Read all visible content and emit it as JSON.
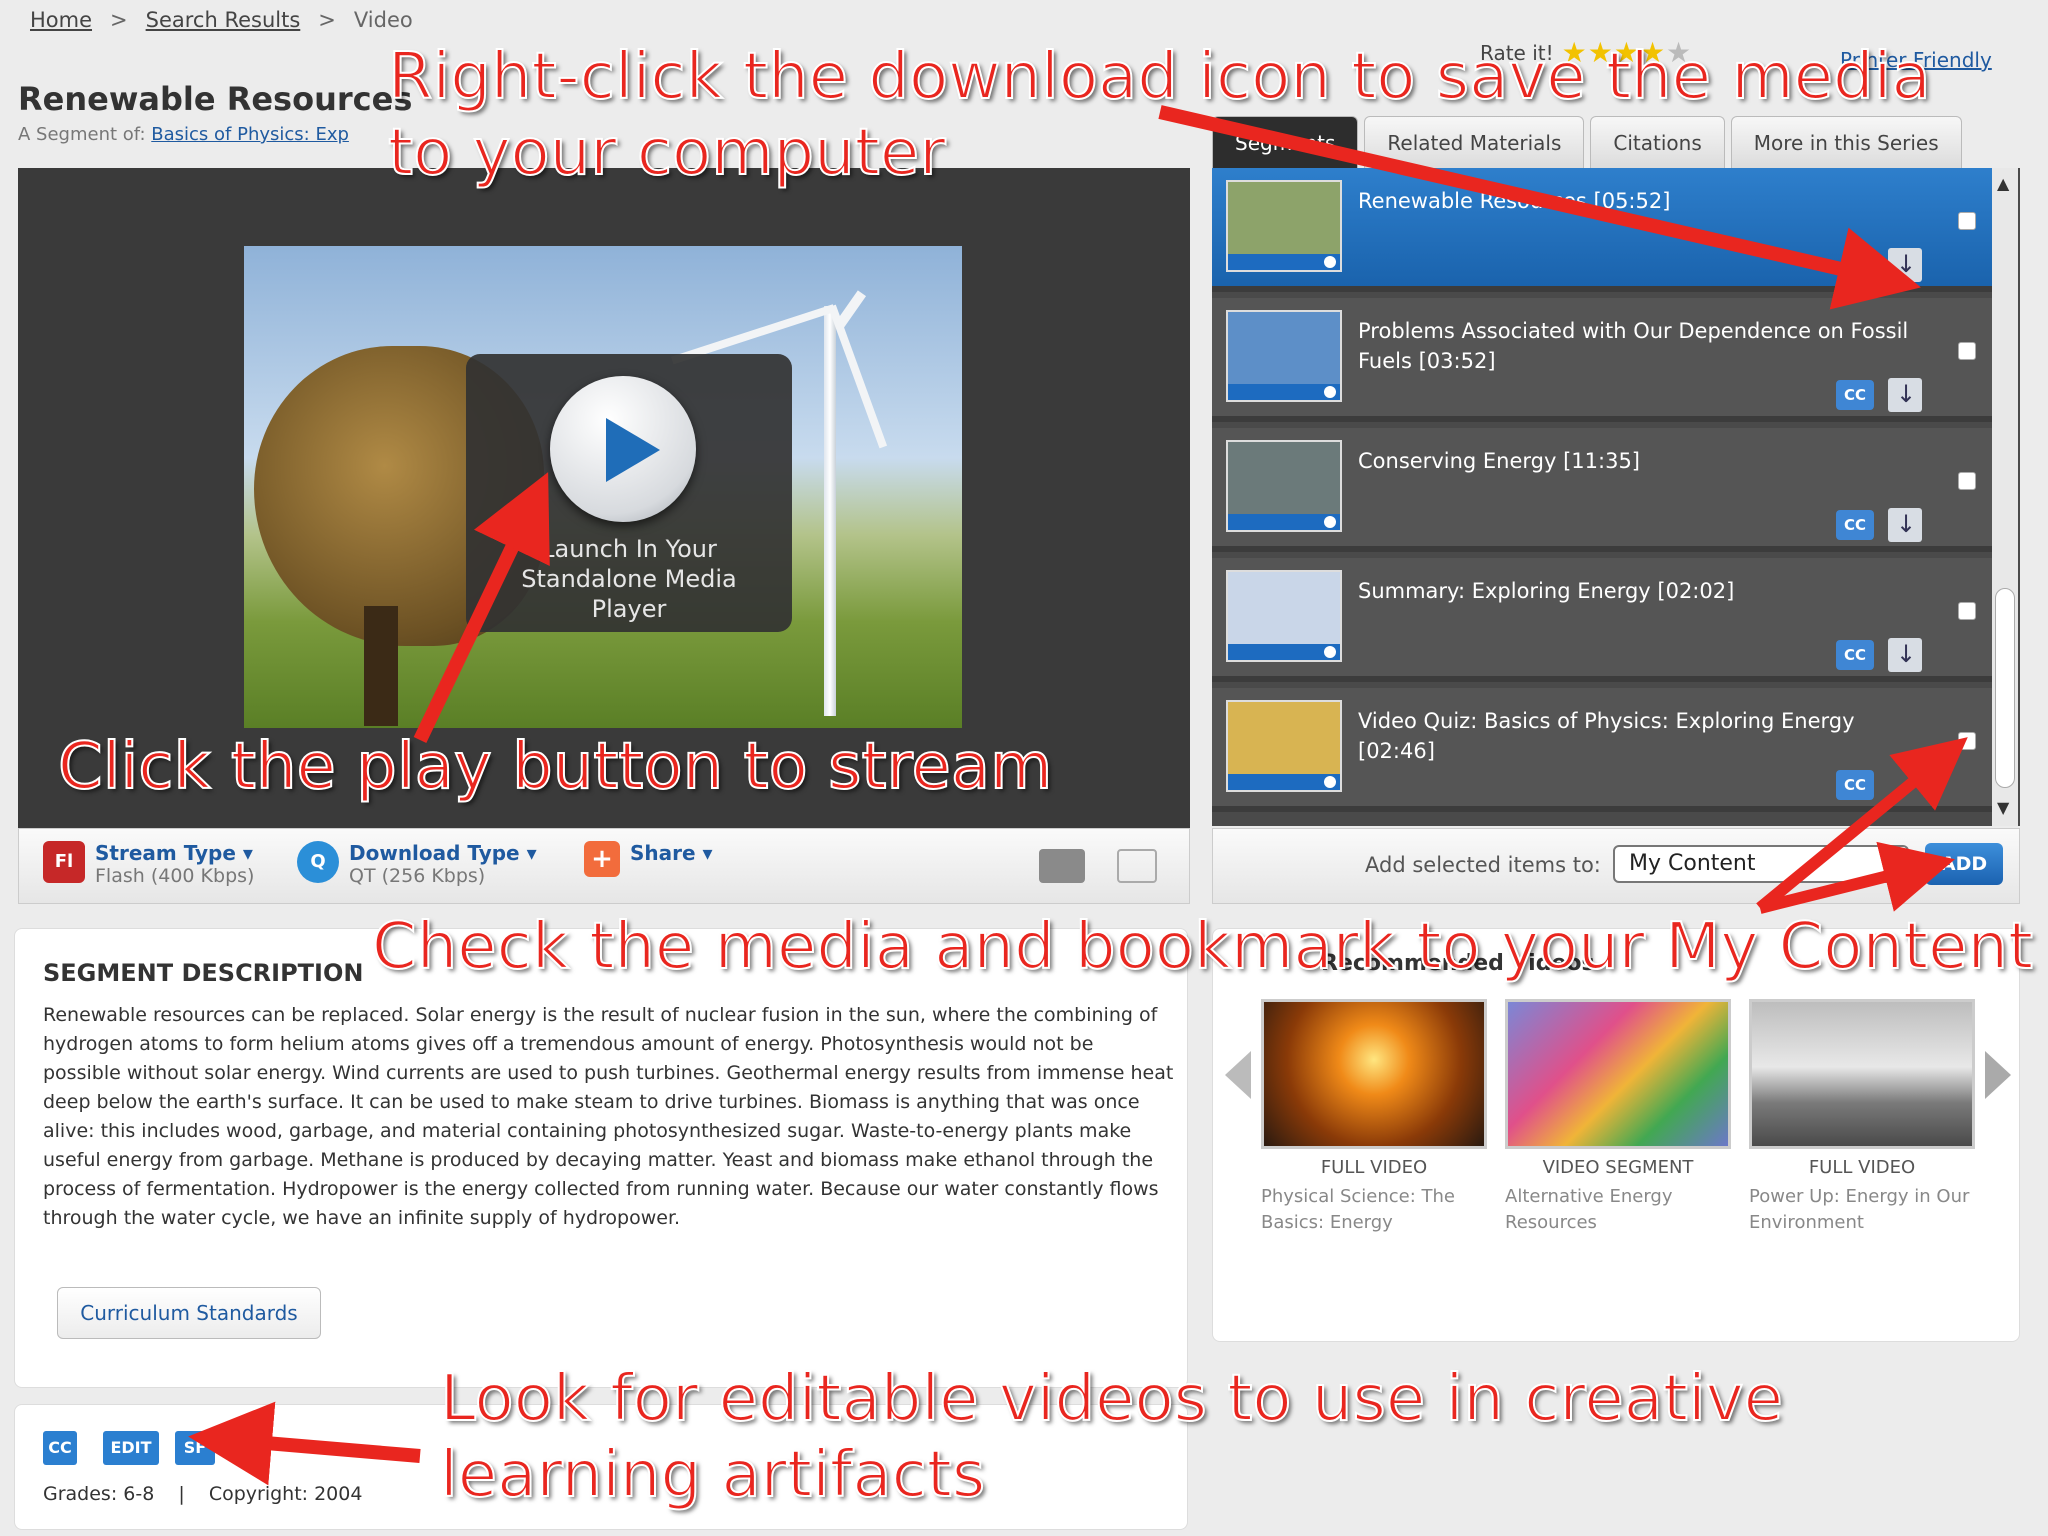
{
  "breadcrumb": {
    "home": "Home",
    "sep": ">",
    "search": "Search Results",
    "current": "Video"
  },
  "page": {
    "title": "Renewable Resources",
    "segment_prefix": "A Segment of:",
    "segment_link": "Basics of Physics: Exp"
  },
  "rate": {
    "label": "Rate it!",
    "stars_on": "★★★★",
    "stars_off": "★"
  },
  "print_link": "Printer Friendly",
  "tabs": [
    {
      "label": "Segments"
    },
    {
      "label": "Related Materials"
    },
    {
      "label": "Citations"
    },
    {
      "label": "More in this Series"
    }
  ],
  "player": {
    "launch_label": "Launch In Your Standalone Media Player"
  },
  "toolbar": {
    "stream_label": "Stream Type ▾",
    "stream_value": "Flash (400 Kbps)",
    "stream_icon": "Fl",
    "download_label": "Download Type ▾",
    "download_value": "QT (256 Kbps)",
    "download_icon": "Q",
    "share_label": "Share ▾",
    "share_icon": "+"
  },
  "segments": [
    {
      "title": "Renewable Resources [05:52]",
      "selected": true,
      "has_cc": false,
      "thumb": "#8da36a"
    },
    {
      "title": "Problems Associated with Our Dependence on Fossil Fuels [03:52]",
      "selected": false,
      "has_cc": true,
      "thumb": "#5d8fc8"
    },
    {
      "title": "Conserving Energy [11:35]",
      "selected": false,
      "has_cc": true,
      "thumb": "#6b7a7a"
    },
    {
      "title": "Summary: Exploring Energy [02:02]",
      "selected": false,
      "has_cc": true,
      "thumb": "#c9d6e8"
    },
    {
      "title": "Video Quiz: Basics of Physics: Exploring Energy [02:46]",
      "selected": false,
      "has_cc": true,
      "thumb": "#d8b452"
    }
  ],
  "cc_label": "CC",
  "add_selected": {
    "label": "Add selected items to:",
    "value": "My Content",
    "button": "ADD"
  },
  "description": {
    "heading": "SEGMENT DESCRIPTION",
    "text": "Renewable resources can be replaced. Solar energy is the result of nuclear fusion in the sun, where the combining of hydrogen atoms to form helium atoms gives off a tremendous amount of energy. Photosynthesis would not be possible without solar energy. Wind currents are used to push turbines. Geothermal energy results from immense heat deep below the earth's surface. It can be used to make steam to drive turbines. Biomass is anything that was once alive: this includes wood, garbage, and material containing photosynthesized sugar. Waste-to-energy plants make useful energy from garbage. Methane is produced by decaying matter. Yeast and biomass make ethanol through the process of fermentation. Hydropower is the energy collected from running water. Because our water constantly flows through the water cycle, we have an infinite supply of hydropower.",
    "curriculum_button": "Curriculum Standards"
  },
  "meta": {
    "badges": [
      "CC",
      "EDIT",
      "SF"
    ],
    "grades": "Grades: 6-8",
    "copyright": "Copyright: 2004"
  },
  "related": {
    "heading": "Recommended Videos",
    "items": [
      {
        "type": "FULL VIDEO",
        "name": "Physical Science: The Basics: Energy"
      },
      {
        "type": "VIDEO SEGMENT",
        "name": "Alternative Energy Resources"
      },
      {
        "type": "FULL VIDEO",
        "name": "Power Up: Energy in Our Environment"
      }
    ]
  },
  "callouts": {
    "download": "Right-click the download icon to save the media",
    "download_line2": "to your computer",
    "play": "Click the play button to stream",
    "bookmark": "Check the media and bookmark to your My Content",
    "editable": "Look for editable videos to use in creative",
    "editable_line2": "learning artifacts"
  },
  "colors": {
    "accent": "#1f5aa0",
    "selected_row": "#2e7fcc",
    "callout": "#e9261f"
  }
}
